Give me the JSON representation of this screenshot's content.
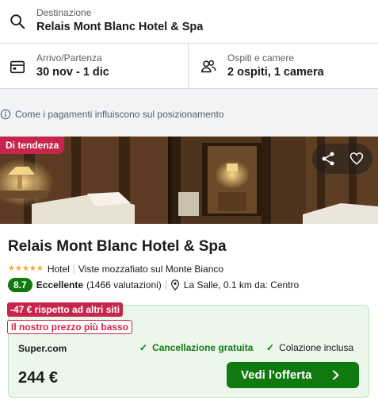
{
  "search": {
    "destination_label": "Destinazione",
    "destination_value": "Relais Mont Blanc Hotel & Spa",
    "dates_label": "Arrivo/Partenza",
    "dates_value": "30 nov - 1 dic",
    "guests_label": "Ospiti e camere",
    "guests_value": "2 ospiti, 1 camera"
  },
  "info_text": "Come i pagamenti influiscono sul posizionamento",
  "hotel": {
    "badge": "Di tendenza",
    "name": "Relais Mont Blanc Hotel & Spa",
    "stars": 5,
    "type": "Hotel",
    "highlight": "Viste mozzafiato sul Monte Bianco",
    "score": "8.7",
    "rating_word": "Eccellente",
    "review_count": "(1466 valutazioni)",
    "location": "La Salle, 0.1 km da: Centro"
  },
  "offer": {
    "discount": "-47 € rispetto ad altri siti",
    "lowest_price": "Il nostro prezzo più basso",
    "provider": "Super.com",
    "feature_1": "Cancellazione gratuita",
    "feature_2": "Colazione inclusa",
    "price": "244 €",
    "cta_label": "Vedi l'offerta"
  },
  "colors": {
    "accent_green": "#107a10",
    "badge_red": "#c7264c",
    "offer_bg": "#ebf7ea",
    "star": "#f5a623"
  },
  "icons": [
    "search-icon",
    "calendar-icon",
    "guests-icon",
    "info-icon",
    "share-icon",
    "heart-icon",
    "location-pin-icon",
    "check-icon",
    "chevron-right-icon"
  ]
}
